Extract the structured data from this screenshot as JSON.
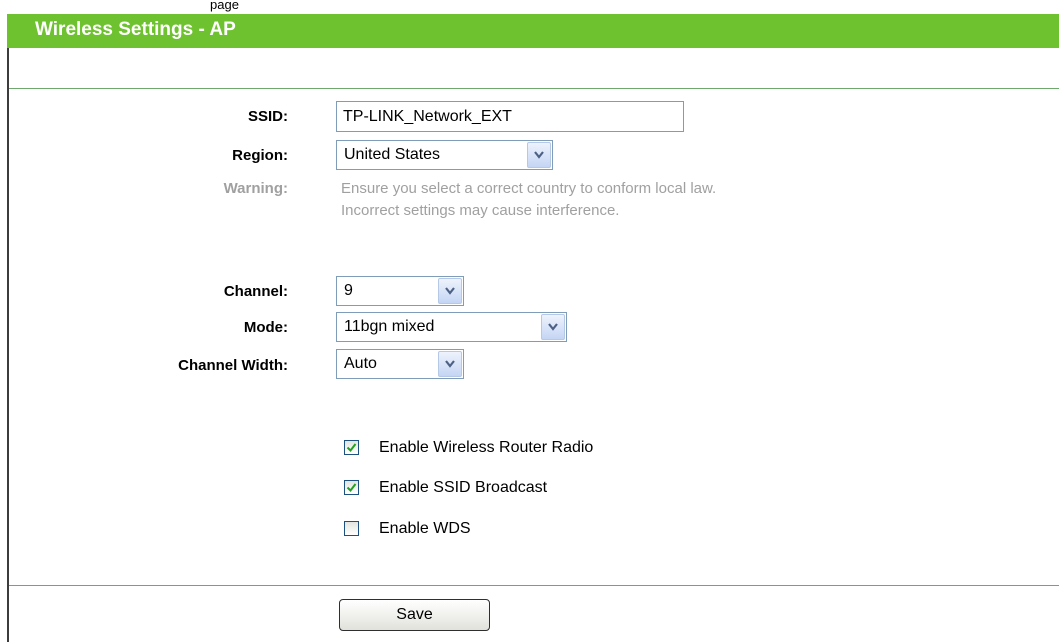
{
  "page": {
    "title": "Wireless Settings - AP",
    "top_fragment": "page"
  },
  "form": {
    "ssid": {
      "label": "SSID:",
      "value": "TP-LINK_Network_EXT"
    },
    "region": {
      "label": "Region:",
      "value": "United States"
    },
    "warning": {
      "label": "Warning:",
      "line1": "Ensure you select a correct country to conform local law.",
      "line2": "Incorrect settings may cause interference."
    },
    "channel": {
      "label": "Channel:",
      "value": "9"
    },
    "mode": {
      "label": "Mode:",
      "value": "11bgn mixed"
    },
    "channel_width": {
      "label": "Channel Width:",
      "value": "Auto"
    },
    "checkboxes": [
      {
        "label": "Enable Wireless Router Radio",
        "checked": true
      },
      {
        "label": "Enable SSID Broadcast",
        "checked": true
      },
      {
        "label": "Enable WDS",
        "checked": false
      }
    ],
    "save_label": "Save"
  },
  "colors": {
    "title_bar": "#6fc22f",
    "warning_text": "#a0a0a0",
    "divider": "#6fa86f"
  },
  "icons": {
    "dropdown": "chevron-down-icon",
    "check": "checkmark-icon"
  }
}
